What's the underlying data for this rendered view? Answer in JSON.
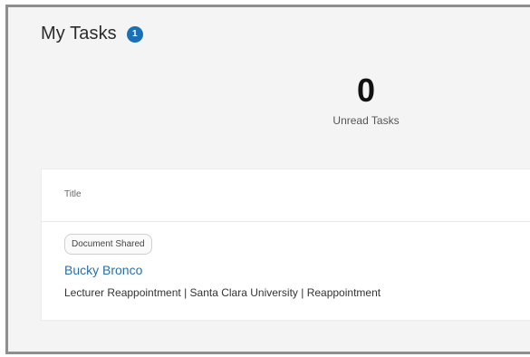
{
  "header": {
    "title": "My Tasks",
    "badge_count": "1"
  },
  "summary": {
    "unread_count": "0",
    "unread_label": "Unread Tasks"
  },
  "task_table": {
    "column_title": "Title",
    "rows": [
      {
        "tag": "Document Shared",
        "name": "Bucky Bronco",
        "description": "Lecturer Reappointment | Santa Clara University | Reappointment"
      }
    ]
  },
  "colors": {
    "accent": "#1b6fb5",
    "link": "#2a6fa8"
  }
}
